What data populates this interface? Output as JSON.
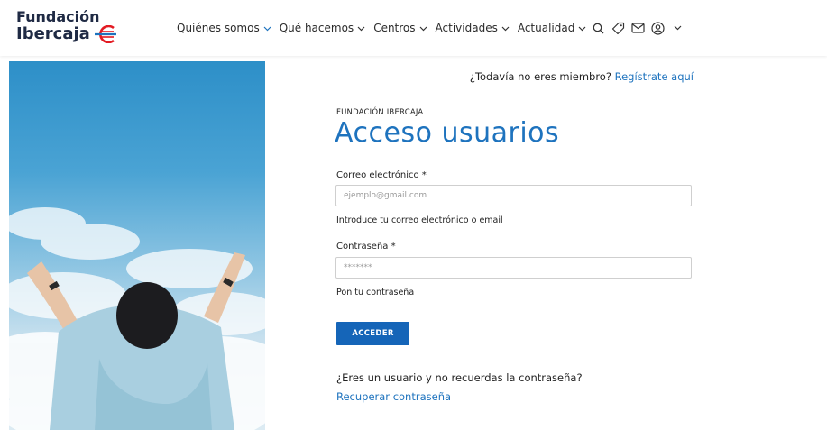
{
  "brand": {
    "line1": "Fundación",
    "line2": "Ibercaja",
    "color": "#1f2a44",
    "accent_red": "#e31b23",
    "accent_blue": "#1e73be"
  },
  "nav": [
    {
      "label": "Quiénes somos",
      "active": true
    },
    {
      "label": "Qué hacemos",
      "active": false
    },
    {
      "label": "Centros",
      "active": false
    },
    {
      "label": "Actividades",
      "active": false
    },
    {
      "label": "Actualidad",
      "active": false
    }
  ],
  "tools": {
    "search": "search-icon",
    "tag": "tag-icon",
    "mail": "mail-icon",
    "user": "user-icon",
    "user_menu": "chevron-down-icon"
  },
  "member_prompt": {
    "text": "¿Todavía no eres miembro?",
    "link": "Regístrate aquí"
  },
  "form": {
    "eyebrow": "FUNDACIÓN IBERCAJA",
    "title": "Acceso usuarios",
    "email_label": "Correo electrónico *",
    "email_placeholder": "ejemplo@gmail.com",
    "email_help": "Introduce tu correo electrónico o email",
    "password_label": "Contraseña *",
    "password_placeholder": "*******",
    "password_help": "Pon tu contraseña",
    "submit": "ACCEDER",
    "forgot_text": "¿Eres un usuario y no recuerdas la contraseña?",
    "recover_link": "Recuperar contraseña"
  },
  "colors": {
    "primary": "#1565b8",
    "link": "#1e73be"
  }
}
